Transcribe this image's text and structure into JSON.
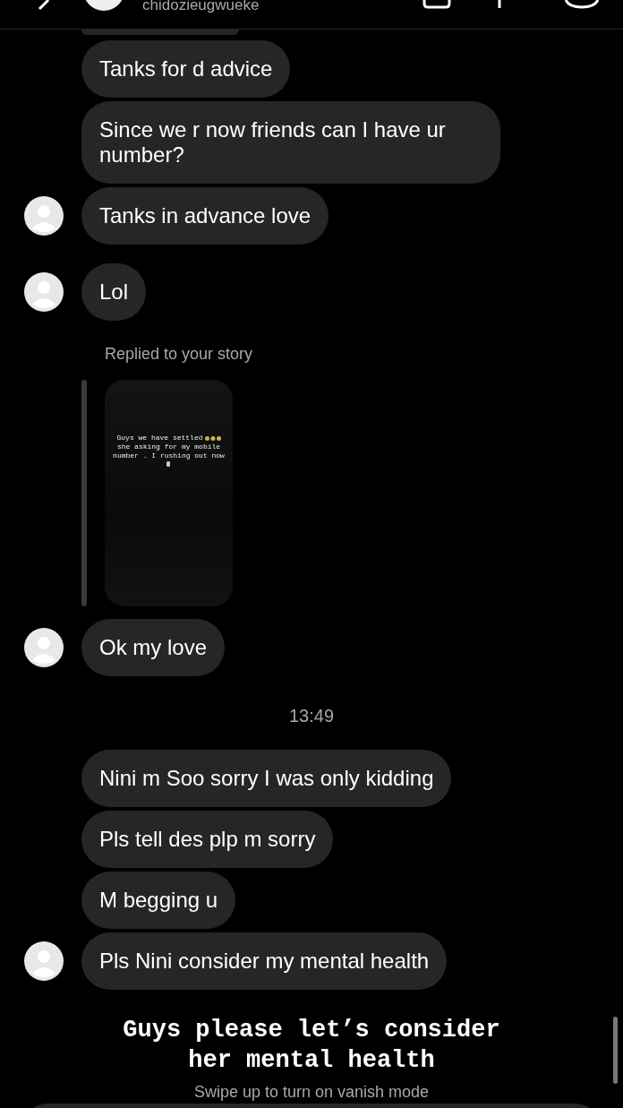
{
  "header": {
    "username": "chidozieugwueke"
  },
  "messages": [
    {
      "kind": "cut"
    },
    {
      "kind": "message",
      "text": "Tanks for d advice",
      "avatar": false
    },
    {
      "kind": "message",
      "text": "Since we r now friends can I have ur number?",
      "avatar": false
    },
    {
      "kind": "message",
      "text": "Tanks in advance love",
      "avatar": true
    },
    {
      "kind": "message",
      "text": "Lol",
      "avatar": true
    },
    {
      "kind": "meta",
      "text": "Replied to your story"
    },
    {
      "kind": "story",
      "lines": [
        "Guys we have settled",
        "she asking for my mobile",
        "number . I rushing out now"
      ]
    },
    {
      "kind": "message",
      "text": "Ok my love",
      "avatar": true
    },
    {
      "kind": "time",
      "text": "13:49"
    },
    {
      "kind": "message",
      "text": "Nini m Soo sorry I was only kidding",
      "avatar": false
    },
    {
      "kind": "message",
      "text": "Pls tell des plp m sorry",
      "avatar": false
    },
    {
      "kind": "message",
      "text": "M begging u",
      "avatar": false
    },
    {
      "kind": "message",
      "text": "Pls Nini consider my mental health",
      "avatar": true
    }
  ],
  "caption": [
    "Guys please let’s consider",
    "her mental health"
  ],
  "hint": "Swipe up to turn on vanish mode"
}
